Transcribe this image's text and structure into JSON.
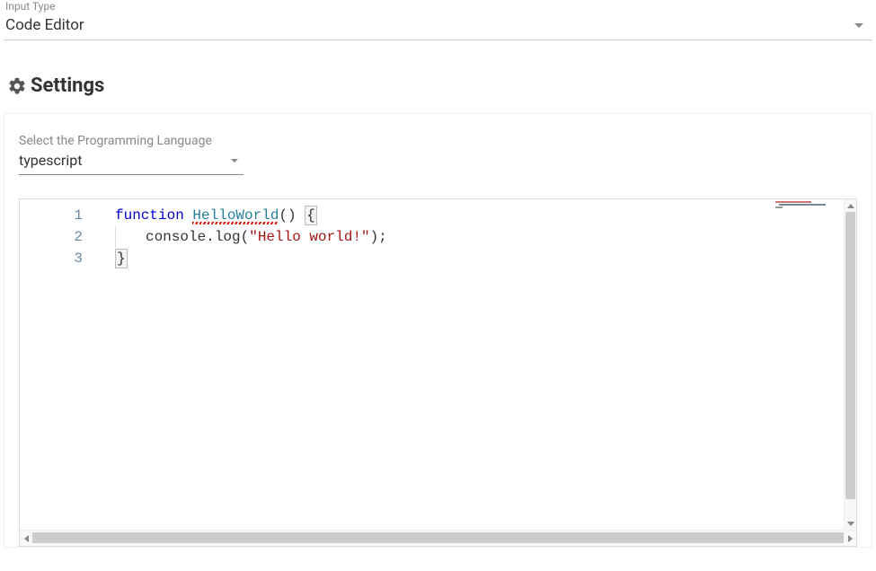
{
  "inputType": {
    "label": "Input Type",
    "value": "Code Editor"
  },
  "settings": {
    "title": "Settings",
    "languageLabel": "Select the Programming Language",
    "language": "typescript"
  },
  "editor": {
    "gutter": [
      "1",
      "2",
      "3"
    ],
    "code": {
      "line1": {
        "keyword": "function",
        "space1": " ",
        "fnName": "HelloWorld",
        "parens": "()",
        "space2": " ",
        "openBrace": "{"
      },
      "line2": {
        "indent": "    ",
        "call": "console.log(",
        "string": "\"Hello world!\"",
        "after": ");"
      },
      "line3": {
        "closeBrace": "}"
      }
    }
  }
}
